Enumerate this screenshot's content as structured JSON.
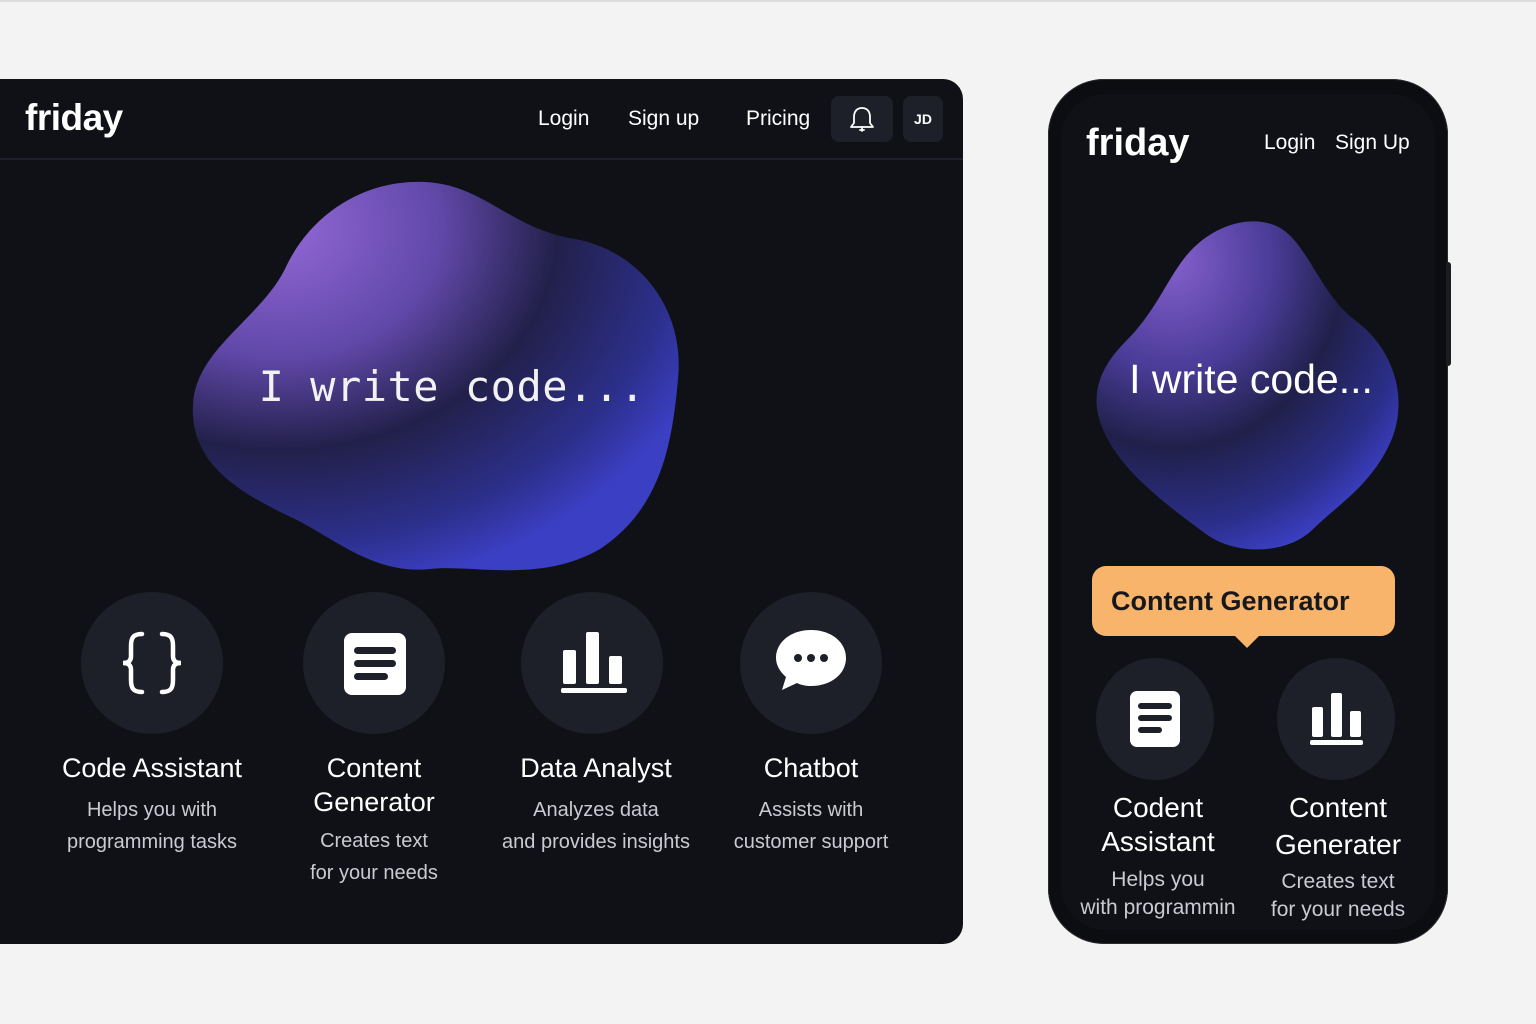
{
  "desktop": {
    "logo": "friday",
    "nav": {
      "login": "Login",
      "signup": "Sign up",
      "pricing": "Pricing"
    },
    "avatar_initials": "JD",
    "hero_text": "I write code...",
    "cards": [
      {
        "icon": "code-braces-icon",
        "title": "Code Assistant",
        "desc_line1": "Helps you with",
        "desc_line2": "programming tasks"
      },
      {
        "icon": "document-icon",
        "title_line1": "Content",
        "title_line2": "Generator",
        "desc_line1": "Creates text",
        "desc_line2": "for your needs"
      },
      {
        "icon": "bar-chart-icon",
        "title": "Data Analyst",
        "desc_line1": "Analyzes data",
        "desc_line2": "and provides insights"
      },
      {
        "icon": "chat-bubble-icon",
        "title": "Chatbot",
        "desc_line1": "Assists with",
        "desc_line2": "customer support"
      }
    ]
  },
  "mobile": {
    "logo": "friday",
    "nav": {
      "login": "Login",
      "signup": "Sign Up"
    },
    "hero_text": "I write code...",
    "tooltip": "Content Generator",
    "cards": [
      {
        "icon": "document-icon",
        "title_line1": "Codent",
        "title_line2": "Assistant",
        "desc_line1": "Helps you",
        "desc_line2": "with programmin"
      },
      {
        "icon": "bar-chart-icon",
        "title_line1": "Content",
        "title_line2": "Generater",
        "desc_line1": "Creates text",
        "desc_line2": "for your needs"
      }
    ]
  },
  "colors": {
    "background": "#0f1117",
    "card_circle": "#1d2028",
    "blob_purple": "#8a62d0",
    "blob_blue": "#3b3fc4",
    "tooltip": "#f8b46a"
  }
}
